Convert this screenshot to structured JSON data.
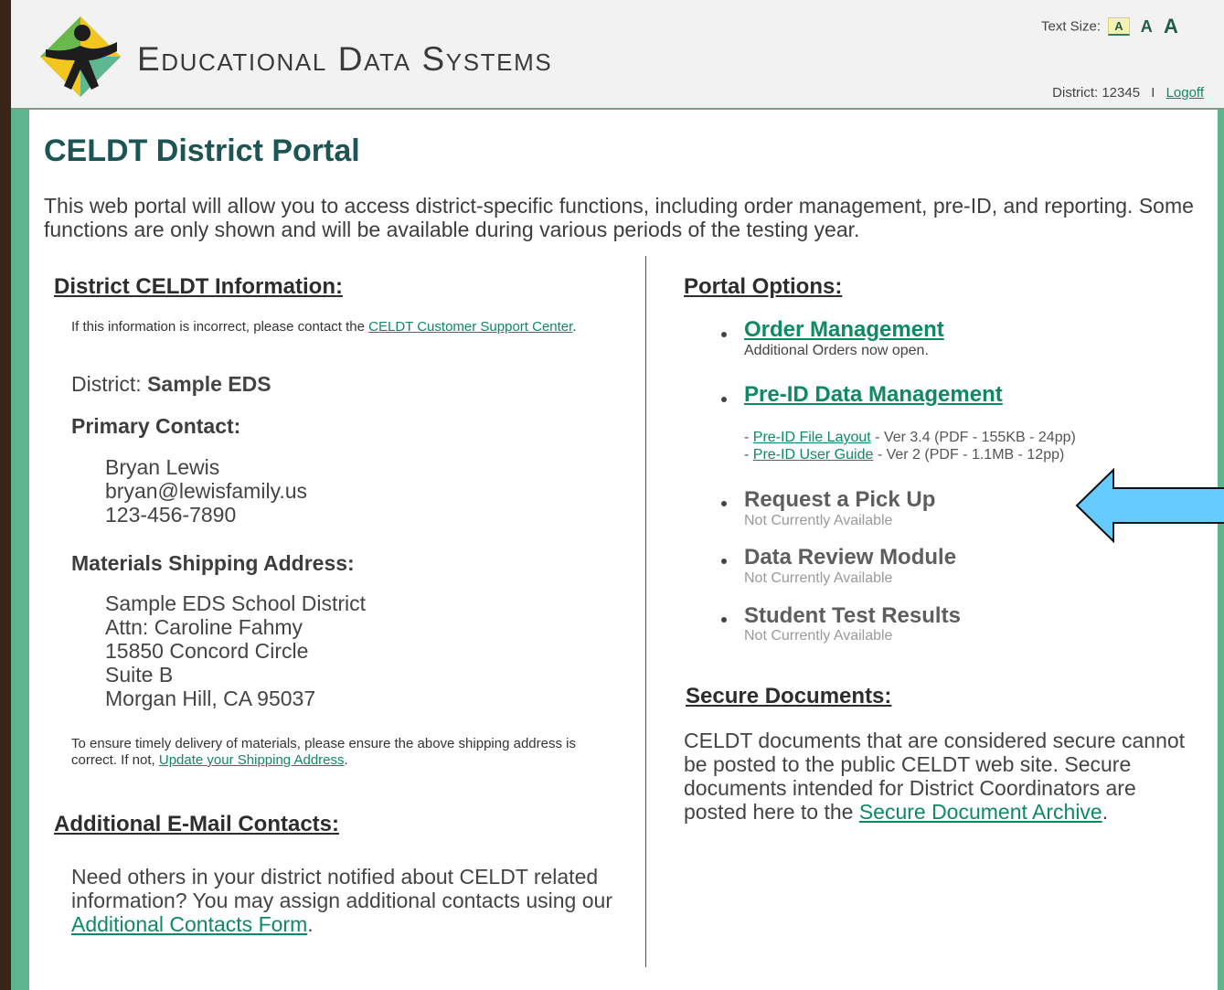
{
  "colors": {
    "accent_green": "#5db48d",
    "link_green": "#0f8a5e",
    "title_teal": "#1d5454",
    "arrow_blue": "#66ccff",
    "outer_brown": "#3a2418"
  },
  "header": {
    "brand": "Educational Data Systems",
    "logo_icon": "figure-on-diamond-logo",
    "text_size_label": "Text Size:",
    "text_size_options": [
      "A",
      "A",
      "A"
    ],
    "district_label": "District: 12345",
    "separator": "I",
    "logoff": "Logoff"
  },
  "page": {
    "title": "CELDT District Portal",
    "intro": "This web portal will allow you to access district-specific functions, including order management, pre-ID, and reporting. Some functions are only shown and will be available during various periods of the testing year."
  },
  "left": {
    "district_info": {
      "heading": "District CELDT Information:",
      "note_prefix": "If this information is incorrect, please contact the ",
      "note_link": "CELDT Customer Support Center",
      "note_suffix": ".",
      "district_label": "District:",
      "district_name": "Sample EDS"
    },
    "primary_contact": {
      "heading": "Primary Contact:",
      "name": "Bryan Lewis",
      "email": "bryan@lewisfamily.us",
      "phone": "123-456-7890"
    },
    "shipping": {
      "heading": "Materials Shipping Address:",
      "lines": [
        "Sample EDS School District",
        "Attn: Caroline Fahmy",
        "15850 Concord Circle",
        "Suite B",
        "Morgan Hill, CA 95037"
      ],
      "note_prefix": "To ensure timely delivery of materials, please ensure the above shipping address is correct. If not, ",
      "note_link": "Update your Shipping Address",
      "note_suffix": "."
    },
    "email_contacts": {
      "heading": "Additional E-Mail Contacts:",
      "text_prefix": "Need others in your district notified about CELDT related information? You may assign additional contacts using our ",
      "link": "Additional Contacts Form",
      "text_suffix": "."
    }
  },
  "right": {
    "portal_options": {
      "heading": "Portal Options:",
      "items": [
        {
          "title": "Order Management",
          "subtitle": "Additional Orders now open."
        },
        {
          "title": "Pre-ID Data Management",
          "subtitle": ""
        },
        {
          "title": "Request a Pick Up",
          "subtitle": "Not Currently Available"
        },
        {
          "title": "Data Review Module",
          "subtitle": "Not Currently Available"
        },
        {
          "title": "Student Test Results",
          "subtitle": "Not Currently Available"
        }
      ],
      "docs": [
        {
          "prefix": "- ",
          "link": "Pre-ID File Layout",
          "text": " - Ver 3.4 (PDF - 155KB - 24pp)"
        },
        {
          "prefix": "- ",
          "link": "Pre-ID User Guide",
          "text": " - Ver 2 (PDF - 1.1MB - 12pp)"
        }
      ]
    },
    "secure_docs": {
      "heading": "Secure Documents:",
      "text_prefix": "CELDT documents that are considered secure cannot be posted to the public CELDT web site. Secure documents intended for District Coordinators are posted here to the ",
      "link": "Secure Document Archive",
      "text_suffix": "."
    }
  },
  "annotation": {
    "arrow_icon": "left-arrow-icon"
  }
}
